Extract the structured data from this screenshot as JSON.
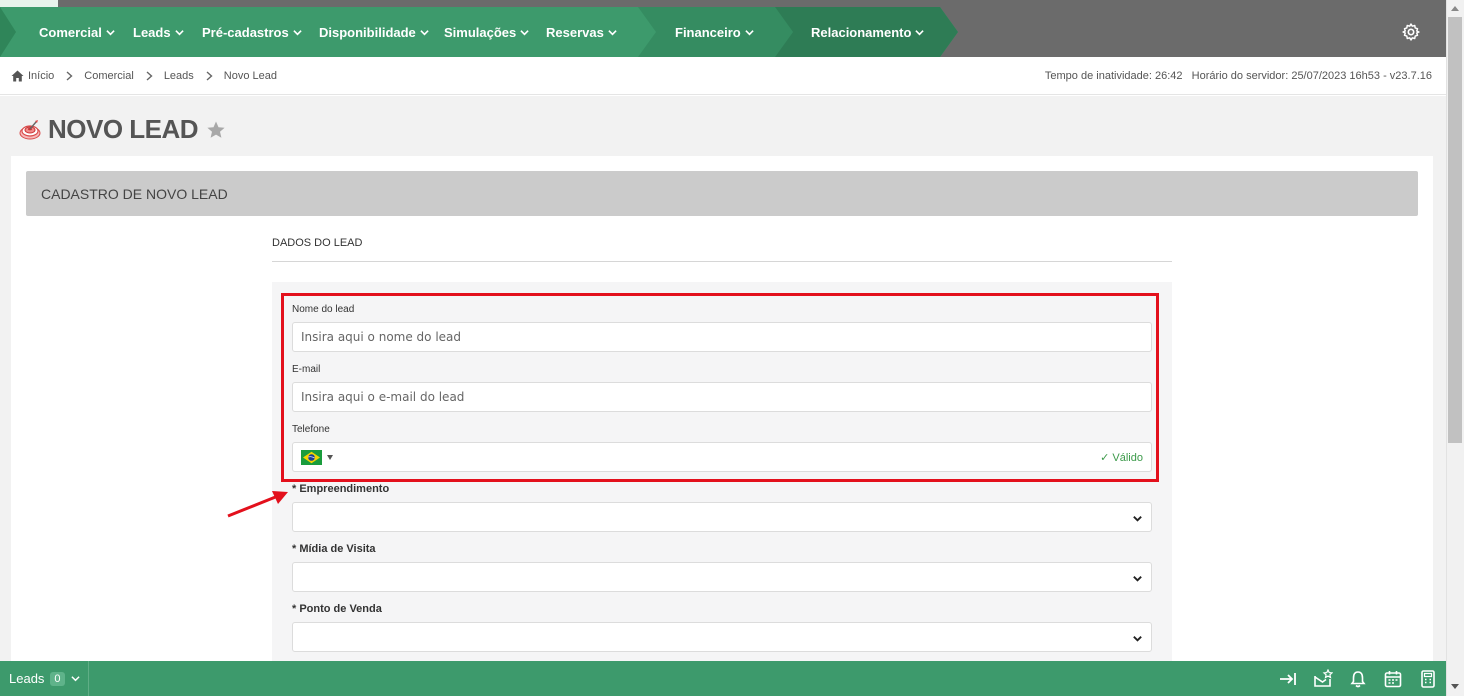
{
  "nav": {
    "items": [
      {
        "label": "Comercial"
      },
      {
        "label": "Leads"
      },
      {
        "label": "Pré-cadastros"
      },
      {
        "label": "Disponibilidade"
      },
      {
        "label": "Simulações"
      },
      {
        "label": "Reservas"
      },
      {
        "label": "Financeiro"
      },
      {
        "label": "Relacionamento"
      }
    ],
    "settings_icon": "gear-icon"
  },
  "breadcrumb": {
    "items": [
      "Início",
      "Comercial",
      "Leads",
      "Novo Lead"
    ],
    "home_icon": "home-icon"
  },
  "server_info": "Tempo de inatividade: 26:42   Horário do servidor: 25/07/2023 16h53 - v23.7.16",
  "page": {
    "title": "NOVO LEAD",
    "card_header": "CADASTRO DE NOVO LEAD",
    "section_title": "DADOS DO LEAD"
  },
  "form": {
    "nome": {
      "label": "Nome do lead",
      "placeholder": "Insira aqui o nome do lead",
      "value": ""
    },
    "email": {
      "label": "E-mail",
      "placeholder": "Insira aqui o e-mail do lead",
      "value": ""
    },
    "telefone": {
      "label": "Telefone",
      "country": "Brazil",
      "status": "✓ Válido"
    },
    "empreendimento": {
      "label": "* Empreendimento",
      "value": ""
    },
    "midia": {
      "label": "* Mídia de Visita",
      "value": ""
    },
    "ponto": {
      "label": "* Ponto de Venda",
      "value": ""
    }
  },
  "bottombar": {
    "leads_label": "Leads",
    "leads_count": "0"
  },
  "colors": {
    "nav_green": "#3d9a6c",
    "highlight_red": "#e3101c",
    "valid_green": "#3c9a4a"
  }
}
